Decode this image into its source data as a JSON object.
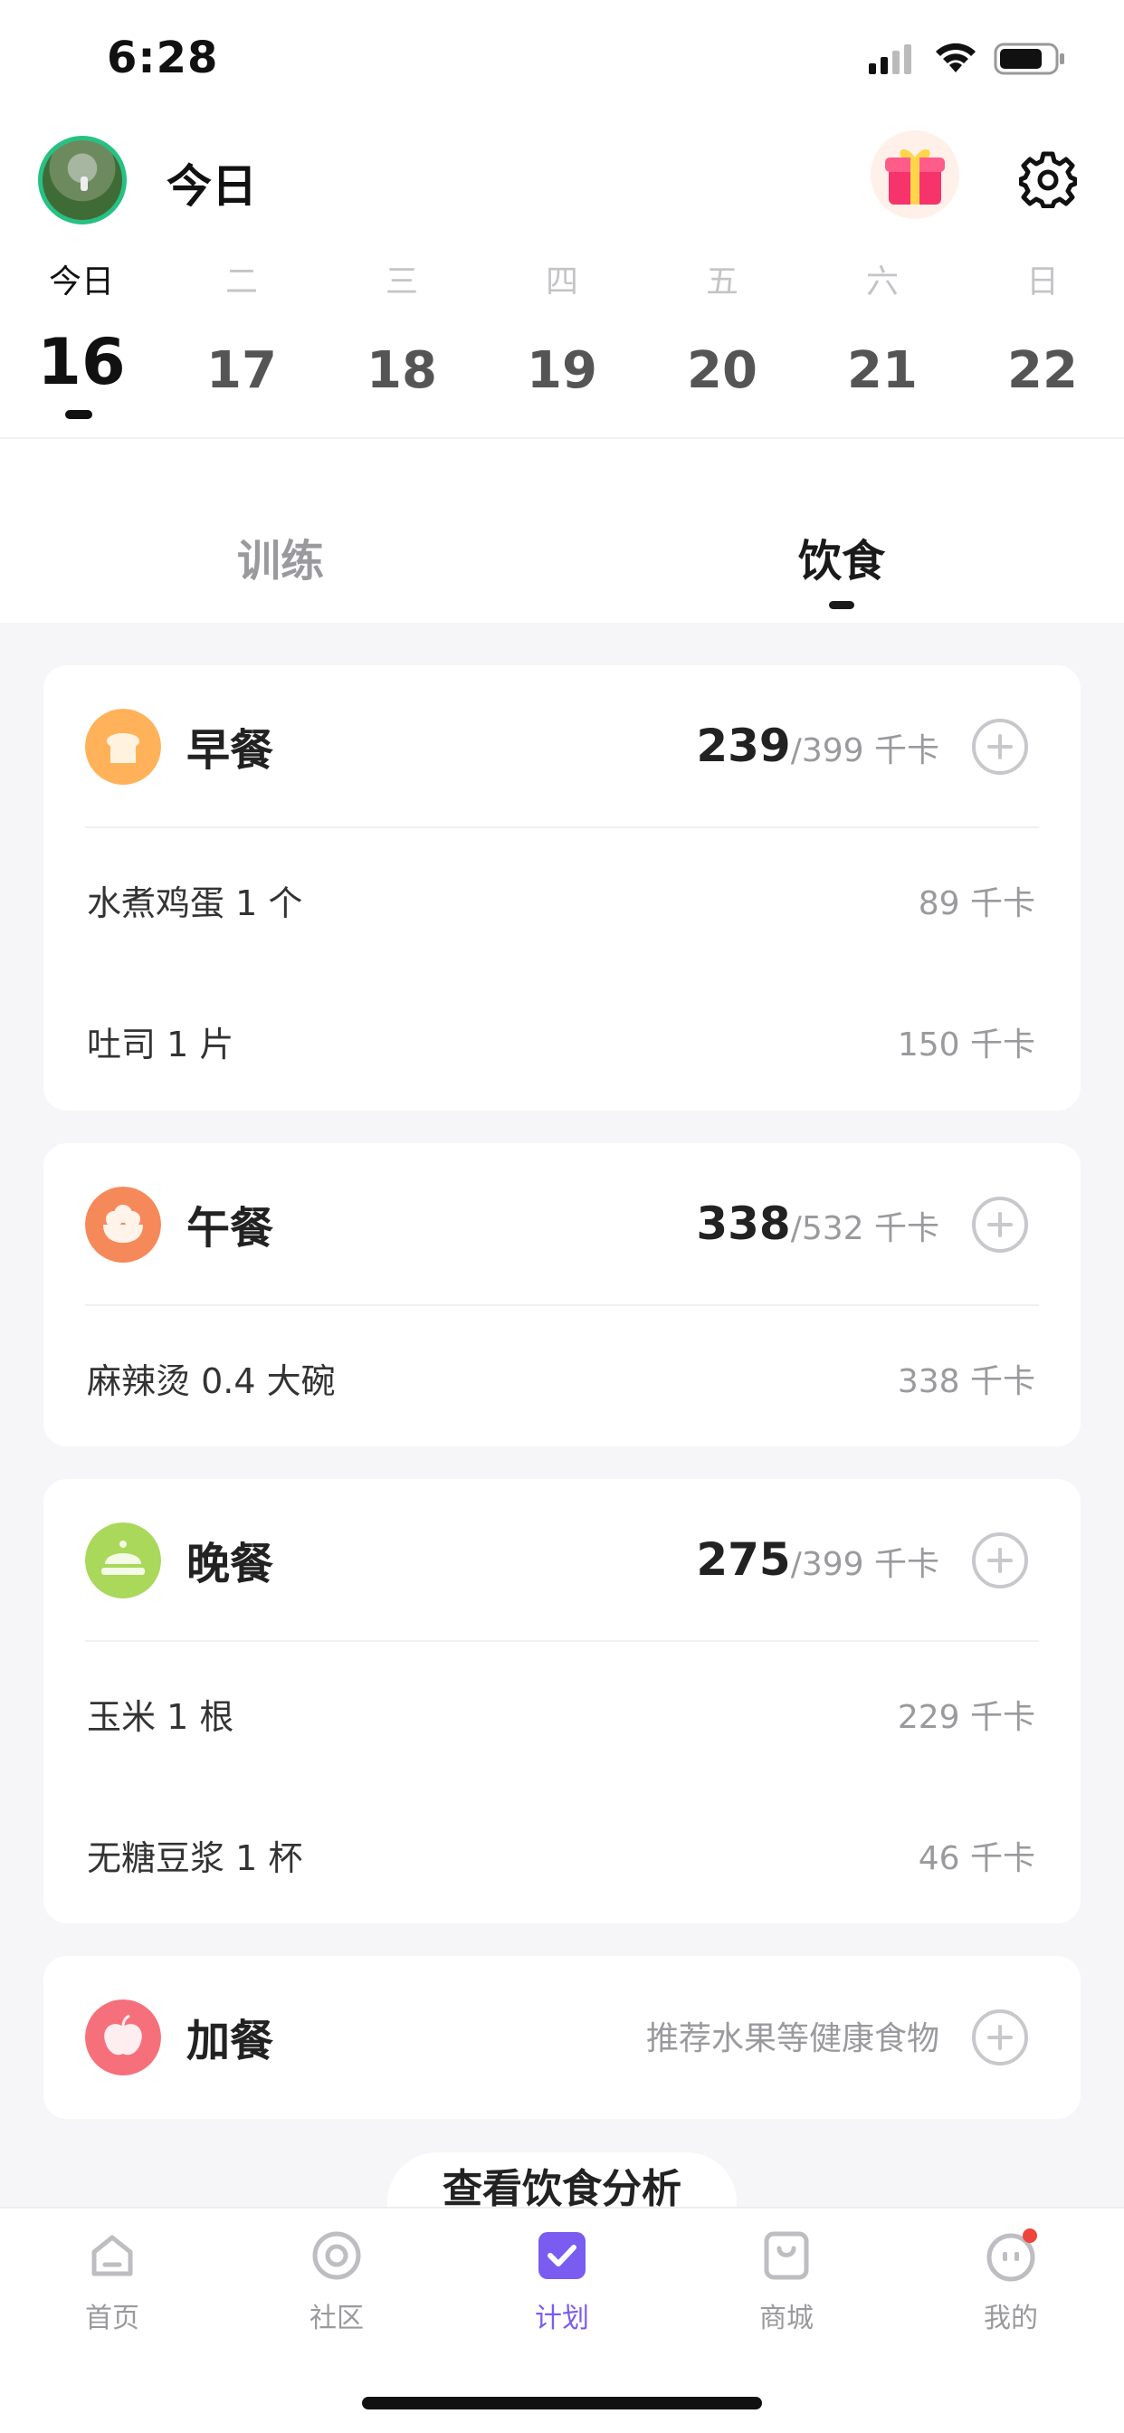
{
  "status_bar": {
    "time": "6:28"
  },
  "header": {
    "title": "今日"
  },
  "week": {
    "days": [
      {
        "weekday": "今日",
        "date": "16"
      },
      {
        "weekday": "二",
        "date": "17"
      },
      {
        "weekday": "三",
        "date": "18"
      },
      {
        "weekday": "四",
        "date": "19"
      },
      {
        "weekday": "五",
        "date": "20"
      },
      {
        "weekday": "六",
        "date": "21"
      },
      {
        "weekday": "日",
        "date": "22"
      }
    ]
  },
  "tabs": {
    "train": "训练",
    "diet": "饮食"
  },
  "meals": {
    "breakfast": {
      "name": "早餐",
      "eaten": "239",
      "target": "/399 千卡",
      "items": [
        {
          "name": "水煮鸡蛋 1 个",
          "kcal": "89 千卡"
        },
        {
          "name": "吐司 1 片",
          "kcal": "150 千卡"
        }
      ]
    },
    "lunch": {
      "name": "午餐",
      "eaten": "338",
      "target": "/532 千卡",
      "items": [
        {
          "name": "麻辣烫 0.4 大碗",
          "kcal": "338 千卡"
        }
      ]
    },
    "dinner": {
      "name": "晚餐",
      "eaten": "275",
      "target": "/399 千卡",
      "items": [
        {
          "name": "玉米 1 根",
          "kcal": "229 千卡"
        },
        {
          "name": "无糖豆浆 1 杯",
          "kcal": "46 千卡"
        }
      ]
    },
    "snack": {
      "name": "加餐",
      "hint": "推荐水果等健康食物"
    }
  },
  "analysis_button": "查看饮食分析",
  "bottom_nav": {
    "home": "首页",
    "community": "社区",
    "plan": "计划",
    "shop": "商城",
    "me": "我的"
  },
  "colors": {
    "accent": "#7b5cf0",
    "avatar_ring": "#27c184",
    "breakfast_icon": "#ffb259",
    "lunch_icon": "#f6895a",
    "dinner_icon": "#a9d85a",
    "snack_icon": "#f6707c",
    "badge": "#f0443a"
  }
}
